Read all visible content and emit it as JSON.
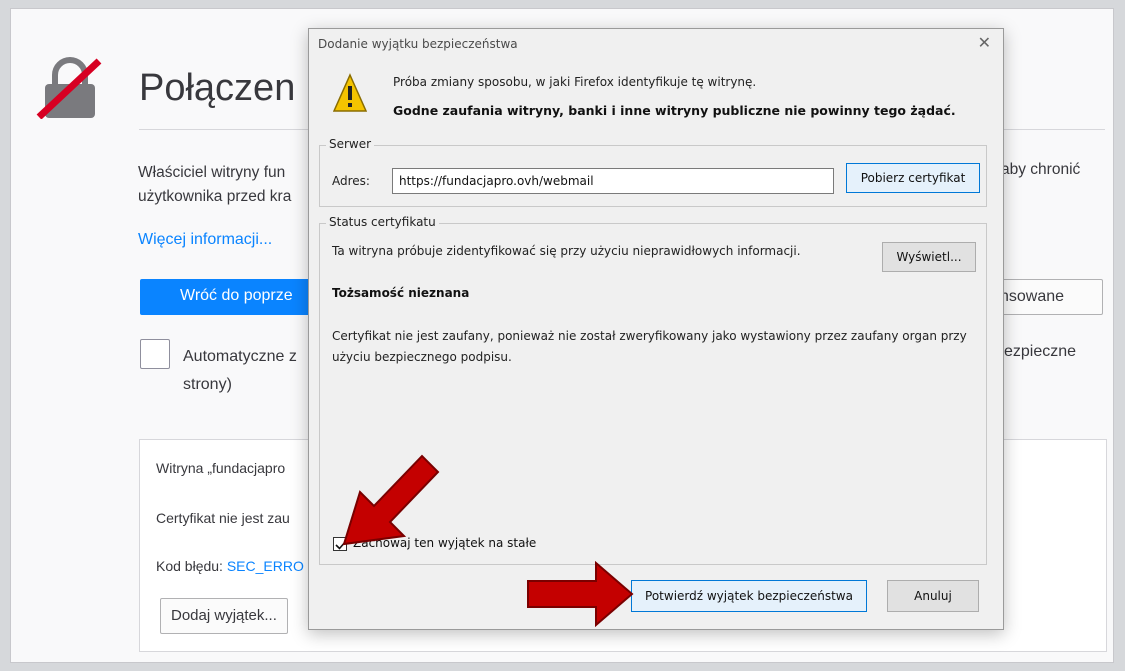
{
  "page": {
    "title": "Połączen",
    "description_line1": "Właściciel witryny fun",
    "description_line2": "użytkownika przed kra",
    "description_right": "aby chronić",
    "more_info_link": "Więcej informacji...",
    "back_button": "Wróć do poprze",
    "advanced_button_partial": "nsowane",
    "report_label_line1": "Automatyczne z",
    "report_label_line2": "strony)",
    "report_label_right": "ezpieczne",
    "advanced_panel": {
      "line1": "Witryna „fundacjapro",
      "line2": "Certyfikat nie jest zau",
      "error_label": "Kod błędu: ",
      "error_code": "SEC_ERRO",
      "add_exception_button": "Dodaj wyjątek..."
    }
  },
  "dialog": {
    "title": "Dodanie wyjątku bezpieczeństwa",
    "close_glyph": "✕",
    "warning_line1": "Próba zmiany sposobu, w jaki Firefox identyfikuje tę witrynę.",
    "warning_line2": "Godne zaufania witryny, banki i inne witryny publiczne nie powinny tego żądać.",
    "server_group_label": "Serwer",
    "address_label": "Adres:",
    "address_value": "https://fundacjapro.ovh/webmail",
    "get_certificate_button": "Pobierz certyfikat",
    "status_group_label": "Status certyfikatu",
    "status_line": "Ta witryna próbuje zidentyfikować się przy użyciu nieprawidłowych informacji.",
    "view_button": "Wyświetl...",
    "identity_heading": "Tożsamość nieznana",
    "certificate_message": "Certyfikat nie jest zaufany, ponieważ nie został zweryfikowany jako wystawiony przez zaufany organ przy użyciu bezpiecznego podpisu.",
    "permanent_checkbox_label": "Zachowaj ten wyjątek na stałe",
    "permanent_checked": true,
    "confirm_button": "Potwierdź wyjątek bezpieczeństwa",
    "cancel_button": "Anuluj"
  },
  "colors": {
    "accent": "#0a84ff",
    "arrow": "#c40000",
    "warning": "#f5c400"
  },
  "icons": {
    "lock": "broken-lock-icon",
    "warning": "warning-triangle-icon",
    "close": "close-icon",
    "check": "checkmark-icon",
    "annotation_arrows": "red-arrow-icon"
  }
}
